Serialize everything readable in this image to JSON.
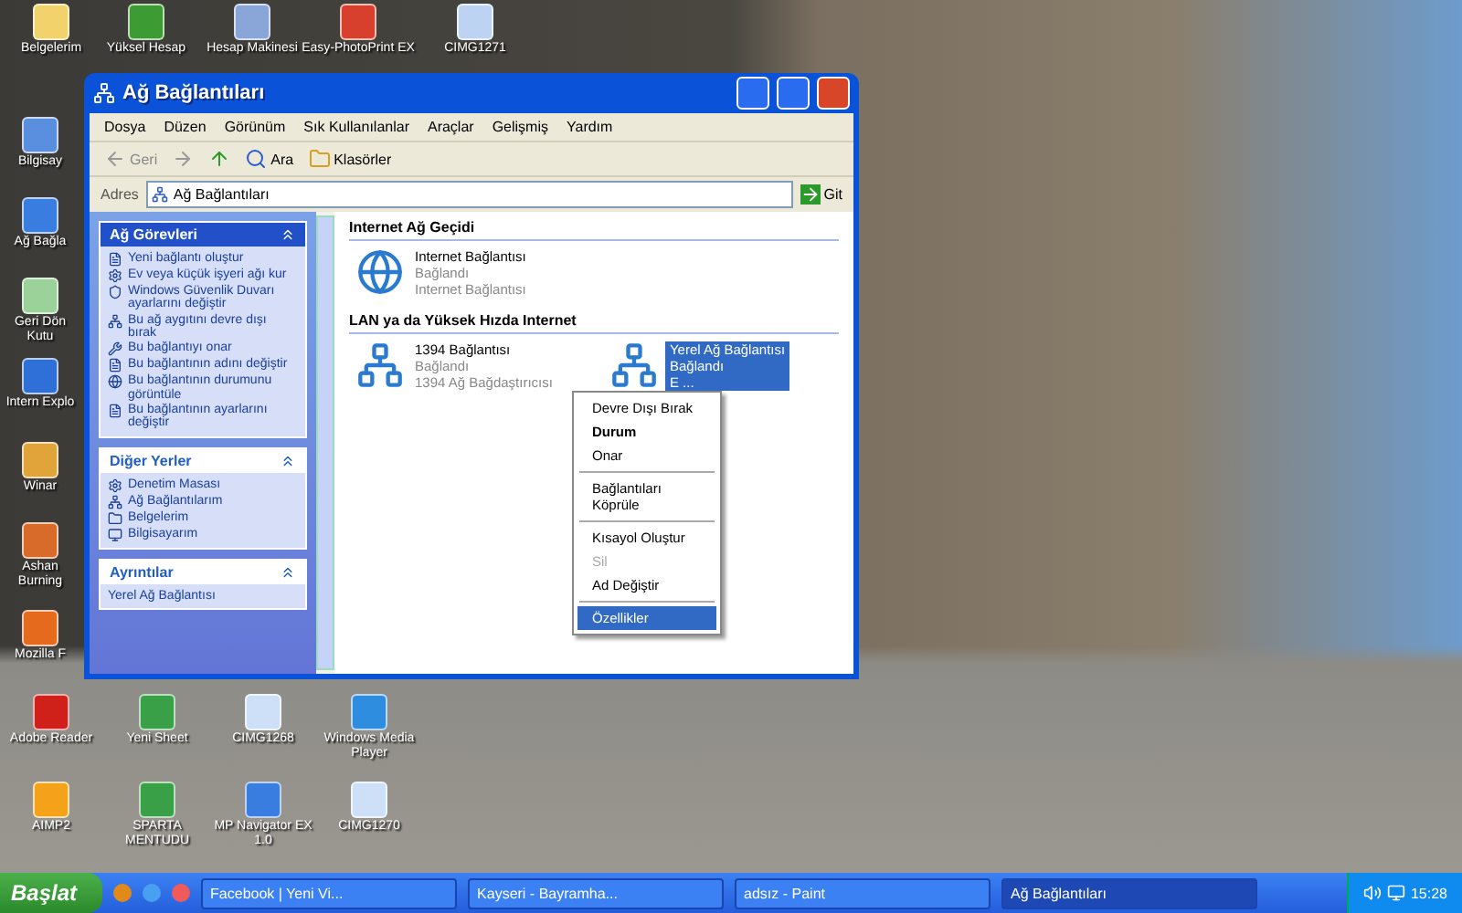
{
  "desktop_icons": [
    {
      "label": "Belgelerim"
    },
    {
      "label": "Yüksel Hesap"
    },
    {
      "label": "Hesap Makinesi"
    },
    {
      "label": "Easy-PhotoPrint EX"
    },
    {
      "label": "CIMG1271"
    },
    {
      "label": "Bilgisay"
    },
    {
      "label": "Ağ Bağla"
    },
    {
      "label": "Geri Dön Kutu"
    },
    {
      "label": "Intern Explo"
    },
    {
      "label": "Winar"
    },
    {
      "label": "Ashan Burning"
    },
    {
      "label": "Mozilla F"
    },
    {
      "label": "Adobe Reader"
    },
    {
      "label": "Yeni Sheet"
    },
    {
      "label": "CIMG1268"
    },
    {
      "label": "Windows Media Player"
    },
    {
      "label": "AIMP2"
    },
    {
      "label": "SPARTA MENTUDU"
    },
    {
      "label": "MP Navigator EX 1.0"
    },
    {
      "label": "CIMG1270"
    }
  ],
  "window": {
    "title": "Ağ Bağlantıları",
    "menu": [
      "Dosya",
      "Düzen",
      "Görünüm",
      "Sık Kullanılanlar",
      "Araçlar",
      "Gelişmiş",
      "Yardım"
    ],
    "toolbar": {
      "back": "Geri",
      "search": "Ara",
      "folders": "Klasörler"
    },
    "address": {
      "label": "Adres",
      "value": "Ağ Bağlantıları",
      "go": "Git"
    },
    "task_panels": [
      {
        "title": "Ağ Görevleri",
        "expanded": true,
        "items": [
          "Yeni bağlantı oluştur",
          "Ev veya küçük işyeri ağı kur",
          "Windows Güvenlik Duvarı ayarlarını değiştir",
          "Bu ağ aygıtını devre dışı bırak",
          "Bu bağlantıyı onar",
          "Bu bağlantının adını değiştir",
          "Bu bağlantının durumunu görüntüle",
          "Bu bağlantının ayarlarını değiştir"
        ]
      },
      {
        "title": "Diğer Yerler",
        "expanded": true,
        "items": [
          "Denetim Masası",
          "Ağ Bağlantılarım",
          "Belgelerim",
          "Bilgisayarım"
        ]
      },
      {
        "title": "Ayrıntılar",
        "expanded": true,
        "items": [
          "Yerel Ağ Bağlantısı"
        ]
      }
    ],
    "groups": [
      {
        "title": "Internet Ağ Geçidi",
        "items": [
          {
            "name": "Internet Bağlantısı",
            "status": "Bağlandı",
            "type": "Internet Bağlantısı",
            "selected": false
          }
        ]
      },
      {
        "title": "LAN ya da Yüksek Hızda Internet",
        "items": [
          {
            "name": "1394 Bağlantısı",
            "status": "Bağlandı",
            "type": "1394 Ağ Bağdaştırıcısı",
            "selected": false
          },
          {
            "name": "Yerel Ağ Bağlantısı",
            "status": "Bağlandı",
            "type": "E ...",
            "selected": true
          }
        ]
      }
    ]
  },
  "context_menu": [
    {
      "kind": "item",
      "label": "Devre Dışı Bırak",
      "bold": false,
      "disabled": false,
      "selected": false
    },
    {
      "kind": "item",
      "label": "Durum",
      "bold": true,
      "disabled": false,
      "selected": false
    },
    {
      "kind": "item",
      "label": "Onar",
      "bold": false,
      "disabled": false,
      "selected": false
    },
    {
      "kind": "separator"
    },
    {
      "kind": "item",
      "label": "Bağlantıları Köprüle",
      "bold": false,
      "disabled": false,
      "selected": false
    },
    {
      "kind": "separator"
    },
    {
      "kind": "item",
      "label": "Kısayol Oluştur",
      "bold": false,
      "disabled": false,
      "selected": false
    },
    {
      "kind": "item",
      "label": "Sil",
      "bold": false,
      "disabled": true,
      "selected": false
    },
    {
      "kind": "item",
      "label": "Ad Değiştir",
      "bold": false,
      "disabled": false,
      "selected": false
    },
    {
      "kind": "separator"
    },
    {
      "kind": "item",
      "label": "Özellikler",
      "bold": false,
      "disabled": false,
      "selected": true
    }
  ],
  "taskbar": {
    "start": "Başlat",
    "tasks": [
      {
        "label": "Facebook | Yeni Vi...",
        "selected": false
      },
      {
        "label": "Kayseri - Bayramha...",
        "selected": false
      },
      {
        "label": "adsız - Paint",
        "selected": false
      },
      {
        "label": "Ağ Bağlantıları",
        "selected": true
      }
    ],
    "clock": "15:28"
  }
}
